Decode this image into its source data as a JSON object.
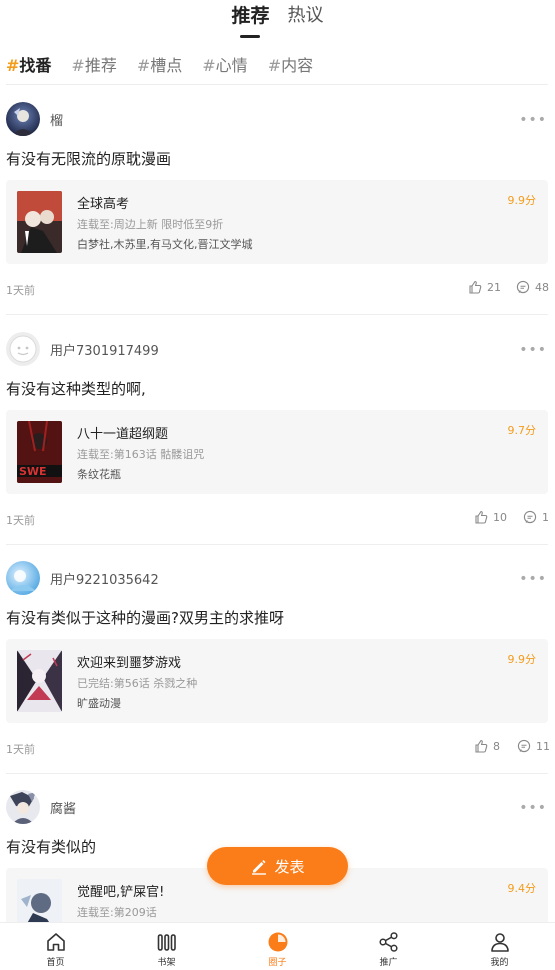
{
  "top_tabs": [
    {
      "label": "推荐",
      "active": true
    },
    {
      "label": "热议",
      "active": false
    }
  ],
  "hashtags": [
    {
      "label": "找番",
      "active": true
    },
    {
      "label": "推荐",
      "active": false
    },
    {
      "label": "槽点",
      "active": false
    },
    {
      "label": "心情",
      "active": false
    },
    {
      "label": "内容",
      "active": false
    }
  ],
  "posts": [
    {
      "username": "榴",
      "text": "有没有无限流的原耽漫画",
      "book": {
        "title": "全球高考",
        "meta": "连载至:周边上新 限时低至9折",
        "publisher": "白梦社,木苏里,有马文化,晋江文学城",
        "score": "9.9分"
      },
      "time": "1天前",
      "likes": "21",
      "comments": "48"
    },
    {
      "username": "用户7301917499",
      "text": "有没有这种类型的啊,",
      "book": {
        "title": "八十一道超纲题",
        "meta": "连载至:第163话 骷髅诅咒",
        "publisher": "条纹花瓶",
        "score": "9.7分"
      },
      "time": "1天前",
      "likes": "10",
      "comments": "1"
    },
    {
      "username": "用户9221035642",
      "text": "有没有类似于这种的漫画?双男主的求推呀",
      "book": {
        "title": "欢迎来到噩梦游戏",
        "meta": "已完结:第56话 杀戮之种",
        "publisher": "旷盛动漫",
        "score": "9.9分"
      },
      "time": "1天前",
      "likes": "8",
      "comments": "11"
    },
    {
      "username": "腐酱",
      "text": "有没有类似的",
      "book": {
        "title": "觉醒吧,铲屎官!",
        "meta": "连载至:第209话",
        "publisher": "",
        "score": "9.4分"
      }
    }
  ],
  "publish_label": "发表",
  "nav": [
    {
      "label": "首页",
      "icon": "home-icon",
      "active": false
    },
    {
      "label": "书架",
      "icon": "bookshelf-icon",
      "active": false
    },
    {
      "label": "圈子",
      "icon": "circle-icon",
      "active": true
    },
    {
      "label": "推广",
      "icon": "share-icon",
      "active": false
    },
    {
      "label": "我的",
      "icon": "profile-icon",
      "active": false
    }
  ],
  "colors": {
    "accent": "#fb7d19",
    "score": "#f39c1b"
  }
}
